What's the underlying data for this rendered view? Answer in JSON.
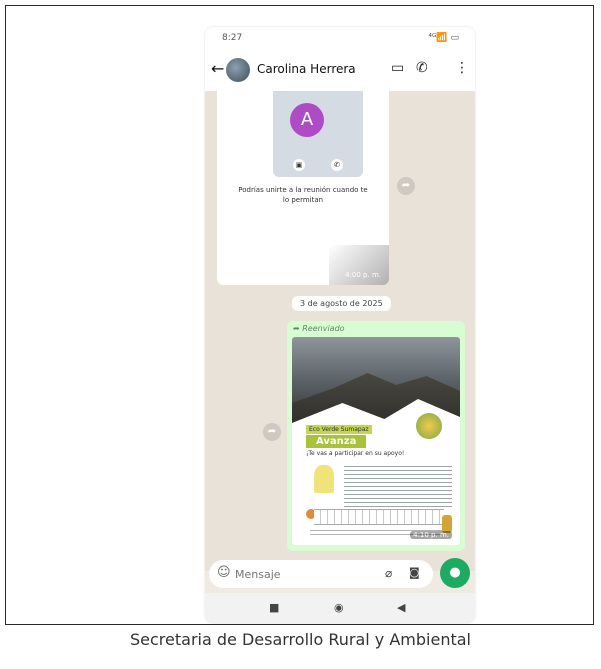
{
  "status": {
    "time": "8:27",
    "time_icon": "whatsapp-icon",
    "right": "⁴ᴳ📶 ▭"
  },
  "contact": {
    "name": "Carolina Herrera"
  },
  "message1": {
    "avatar_letter": "A",
    "text": "Podrías unirte a la reunión cuando te lo permitan",
    "time": "4:00 p. m."
  },
  "date_separator": "3 de agosto de 2025",
  "message2": {
    "forwarded_label": "Reenviado",
    "poster_title": "Eco Verde Sumapaz",
    "poster_headline": "Avanza",
    "poster_subtitle": "¡Te vas a participar en su apoyo!",
    "time": "4:10 p. m."
  },
  "composer": {
    "placeholder": "Mensaje"
  },
  "caption": "Secretaria de Desarrollo Rural y Ambiental",
  "colors": {
    "chat_bg": "#e9e2d8",
    "outgoing_bubble": "#d9fdd3",
    "mic": "#1daa61",
    "avatar": "#ae4cc6"
  }
}
